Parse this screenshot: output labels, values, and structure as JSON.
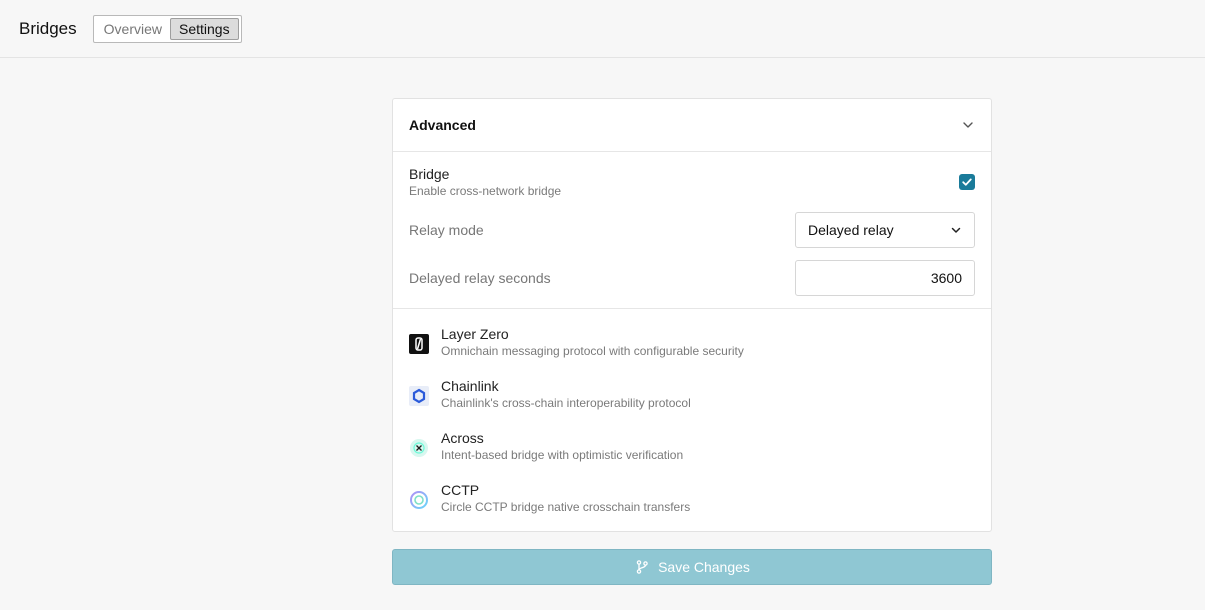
{
  "header": {
    "title": "Bridges",
    "tabs": [
      {
        "label": "Overview",
        "active": false
      },
      {
        "label": "Settings",
        "active": true
      }
    ]
  },
  "advanced": {
    "title": "Advanced",
    "bridge": {
      "label": "Bridge",
      "description": "Enable cross-network bridge",
      "enabled": true
    },
    "relay_mode": {
      "label": "Relay mode",
      "value": "Delayed relay"
    },
    "delayed_relay_seconds": {
      "label": "Delayed relay seconds",
      "value": "3600"
    }
  },
  "bridges": [
    {
      "name": "Layer Zero",
      "description": "Omnichain messaging protocol with configurable security",
      "icon": "layerzero-icon"
    },
    {
      "name": "Chainlink",
      "description": "Chainlink's cross-chain interoperability protocol",
      "icon": "chainlink-icon"
    },
    {
      "name": "Across",
      "description": "Intent-based bridge with optimistic verification",
      "icon": "across-icon"
    },
    {
      "name": "CCTP",
      "description": "Circle CCTP bridge native crosschain transfers",
      "icon": "cctp-icon"
    }
  ],
  "save_button": {
    "label": "Save Changes"
  },
  "colors": {
    "accent": "#1a7b9a",
    "save_disabled": "#8fc7d3"
  }
}
